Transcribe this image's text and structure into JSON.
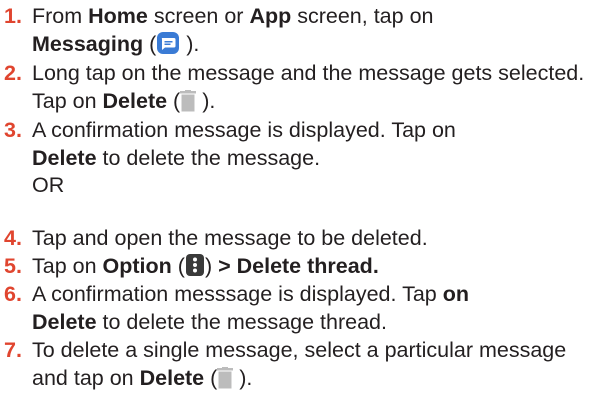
{
  "steps": [
    {
      "number": "1.",
      "parts": [
        "From ",
        "Home",
        " screen or ",
        "App",
        " screen, tap on",
        "Messaging",
        " (",
        " )."
      ],
      "icon": "messaging-icon"
    },
    {
      "number": "2.",
      "parts": [
        "Long tap on the message and the message gets selected. Tap on ",
        "Delete",
        " (",
        " )."
      ],
      "icon": "trash-icon"
    },
    {
      "number": "3.",
      "parts": [
        "A confirmation message is displayed. Tap on",
        "Delete",
        " to delete the message."
      ]
    },
    {
      "separator": "OR"
    },
    {
      "number": "4.",
      "parts": [
        "Tap and open the message to be deleted."
      ]
    },
    {
      "number": "5.",
      "parts": [
        "Tap on ",
        "Option",
        " (",
        ") ",
        "> Delete thread."
      ],
      "icon": "more-options-icon"
    },
    {
      "number": "6.",
      "parts": [
        "A confirmation messsage is displayed. Tap ",
        "on",
        "Delete",
        " to delete the message thread."
      ]
    },
    {
      "number": "7.",
      "parts": [
        "To delete a single message, select a particular message and tap on ",
        "Delete",
        " (",
        " )."
      ],
      "icon": "trash-icon"
    }
  ],
  "colors": {
    "number": "#e0452f",
    "text": "#231f20",
    "messaging_icon": "#3a7bd5",
    "trash_icon": "#bcbcbc",
    "options_icon": "#3a3a3a"
  }
}
